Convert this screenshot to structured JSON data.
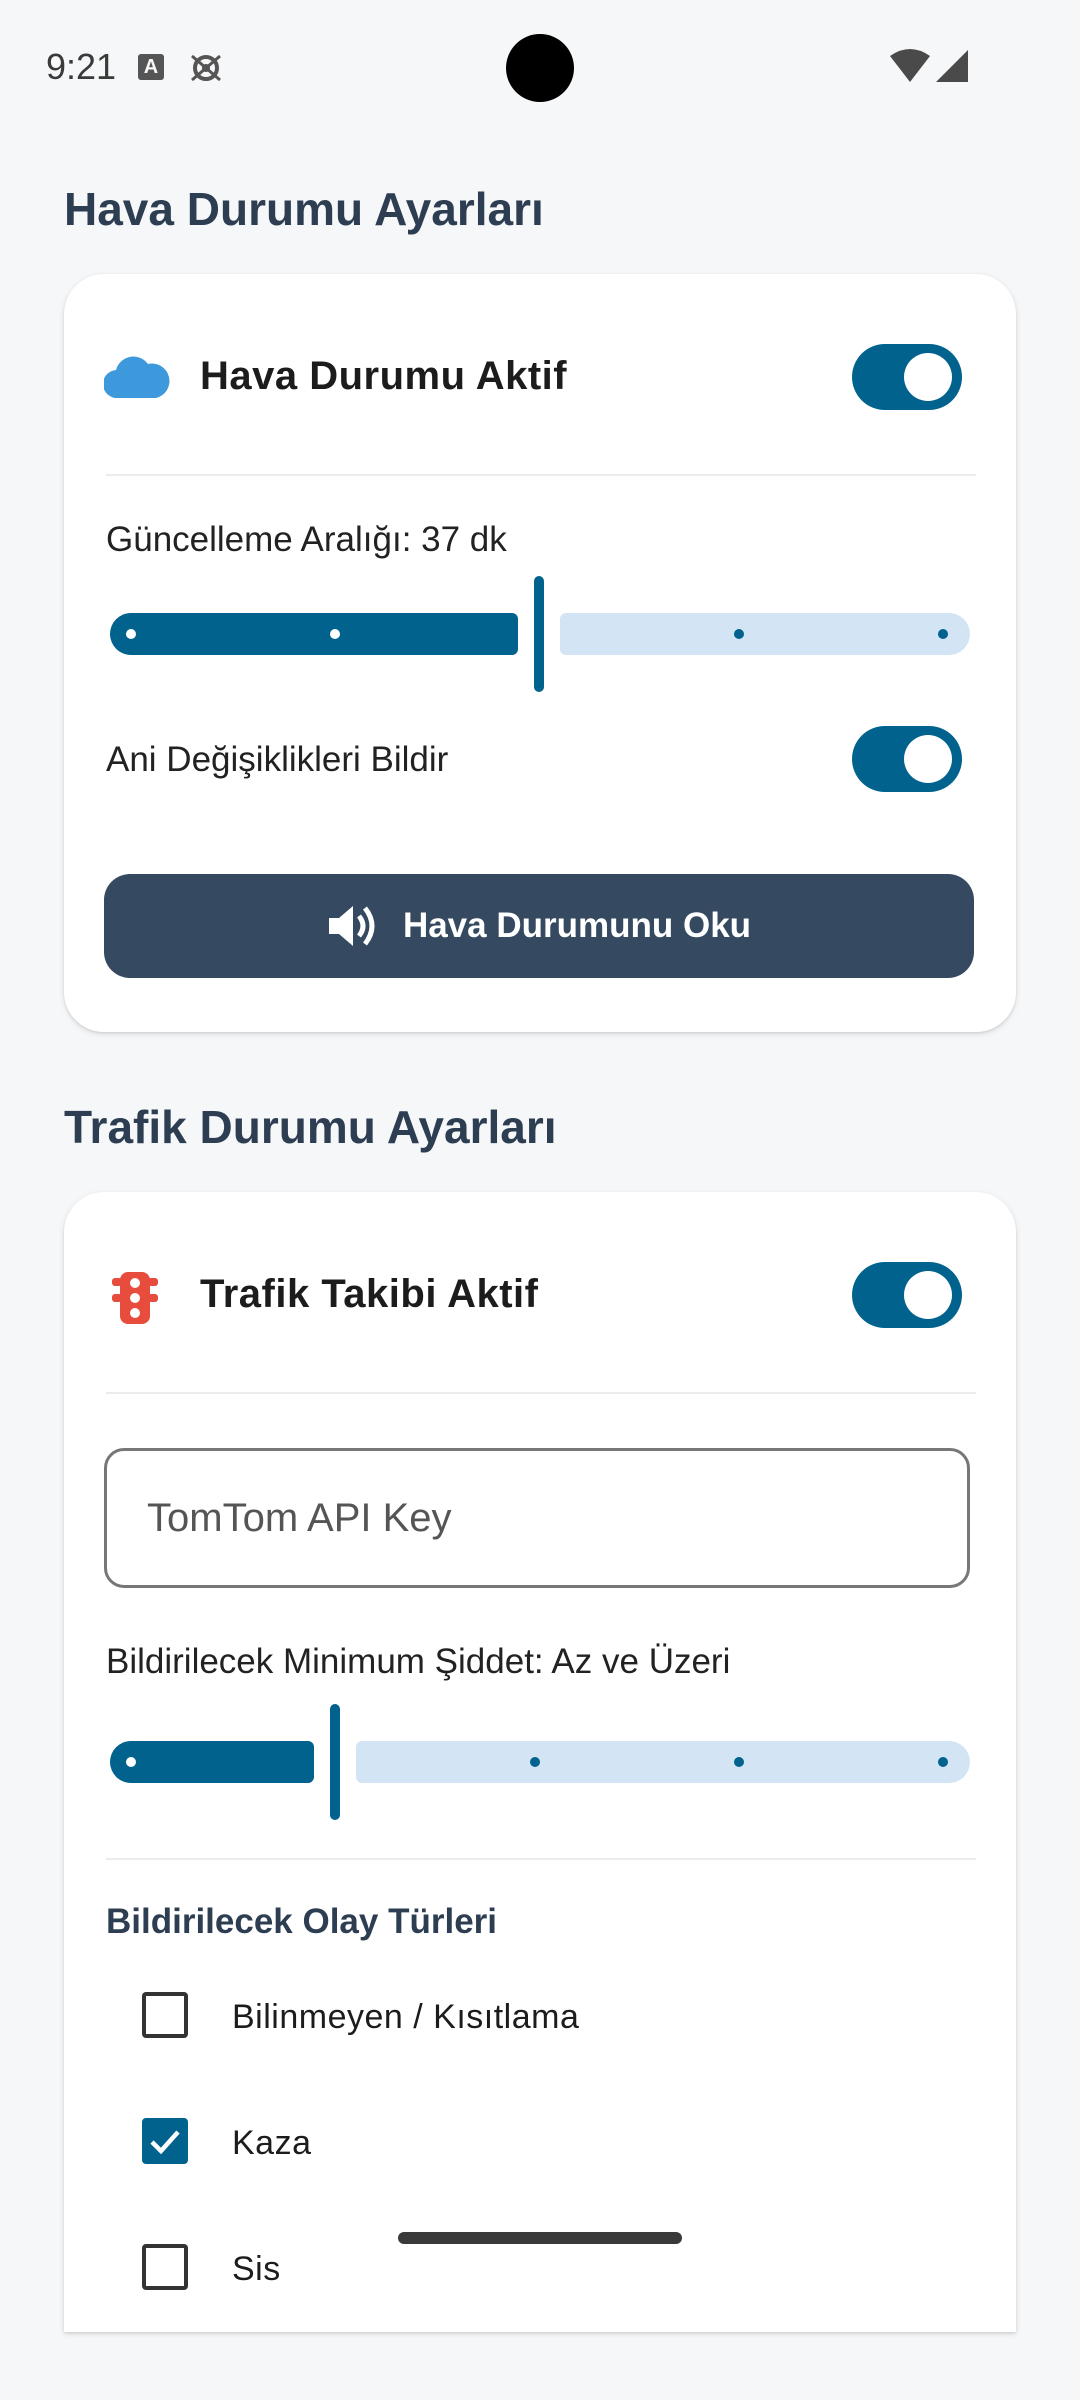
{
  "status_bar": {
    "time": "9:21",
    "notification_icon_letter": "A",
    "icons": [
      "a-notification-icon",
      "gear-icon",
      "wifi-icon",
      "signal-icon"
    ]
  },
  "weather_section": {
    "title": "Hava Durumu Ayarları",
    "enabled_label": "Hava Durumu Aktif",
    "enabled": true,
    "icon": "cloud-icon",
    "interval_label": "Güncelleme Aralığı: 37 dk",
    "interval_slider_steps": 5,
    "interval_slider_fraction": 0.5,
    "sudden_changes_label": "Ani Değişiklikleri Bildir",
    "sudden_changes_enabled": true,
    "read_button_label": "Hava Durumunu Oku",
    "read_button_icon": "speaker-icon"
  },
  "traffic_section": {
    "title": "Trafik Durumu Ayarları",
    "enabled_label": "Trafik Takibi Aktif",
    "enabled": true,
    "icon": "traffic-light-icon",
    "api_key_placeholder": "TomTom API Key",
    "api_key_value": "",
    "severity_label": "Bildirilecek Minimum Şiddet: Az ve Üzeri",
    "severity_slider_steps": 5,
    "severity_slider_fraction": 0.25,
    "event_types_title": "Bildirilecek Olay Türleri",
    "event_types": [
      {
        "label": "Bilinmeyen / Kısıtlama",
        "checked": false
      },
      {
        "label": "Kaza",
        "checked": true
      },
      {
        "label": "Sis",
        "checked": false
      }
    ]
  },
  "colors": {
    "accent": "#00628d",
    "slider_track_inactive": "#d3e5f5",
    "button_bg": "#354a60",
    "section_title": "#2d3e52",
    "cloud_icon": "#3d99dc",
    "traffic_icon": "#e74c3c",
    "background": "#f6f7f8"
  }
}
